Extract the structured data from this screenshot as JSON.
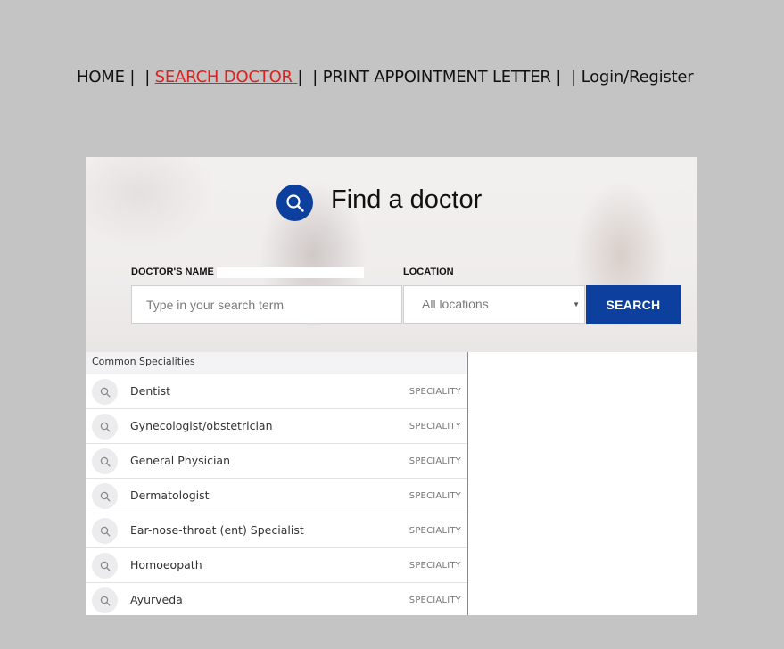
{
  "nav": {
    "home": "HOME",
    "sep1": " |  | ",
    "search_doctor": "SEARCH DOCTOR ",
    "sep2": "|  | ",
    "print_letter": "PRINT APPOINTMENT LETTER",
    "sep3": " |  | ",
    "login": "Login/Register"
  },
  "finder": {
    "title": "Find a doctor",
    "doctor_label": "DOCTOR'S NAME",
    "location_label": "LOCATION",
    "search_placeholder": "Type in your search term",
    "location_value": "All locations",
    "search_button": "SEARCH"
  },
  "specialities": {
    "header": "Common Specialities",
    "items": [
      {
        "name": "Dentist",
        "tag": "SPECIALITY"
      },
      {
        "name": "Gynecologist/obstetrician",
        "tag": "SPECIALITY"
      },
      {
        "name": "General Physician",
        "tag": "SPECIALITY"
      },
      {
        "name": "Dermatologist",
        "tag": "SPECIALITY"
      },
      {
        "name": "Ear-nose-throat (ent) Specialist",
        "tag": "SPECIALITY"
      },
      {
        "name": "Homoeopath",
        "tag": "SPECIALITY"
      },
      {
        "name": "Ayurveda",
        "tag": "SPECIALITY"
      }
    ]
  },
  "colors": {
    "accent": "#0d3f9e",
    "active_link": "#e0201c",
    "background": "#c4c4c4"
  },
  "icons": {
    "find": "search-icon",
    "row": "search-icon",
    "select_caret": "caret-down-icon"
  }
}
